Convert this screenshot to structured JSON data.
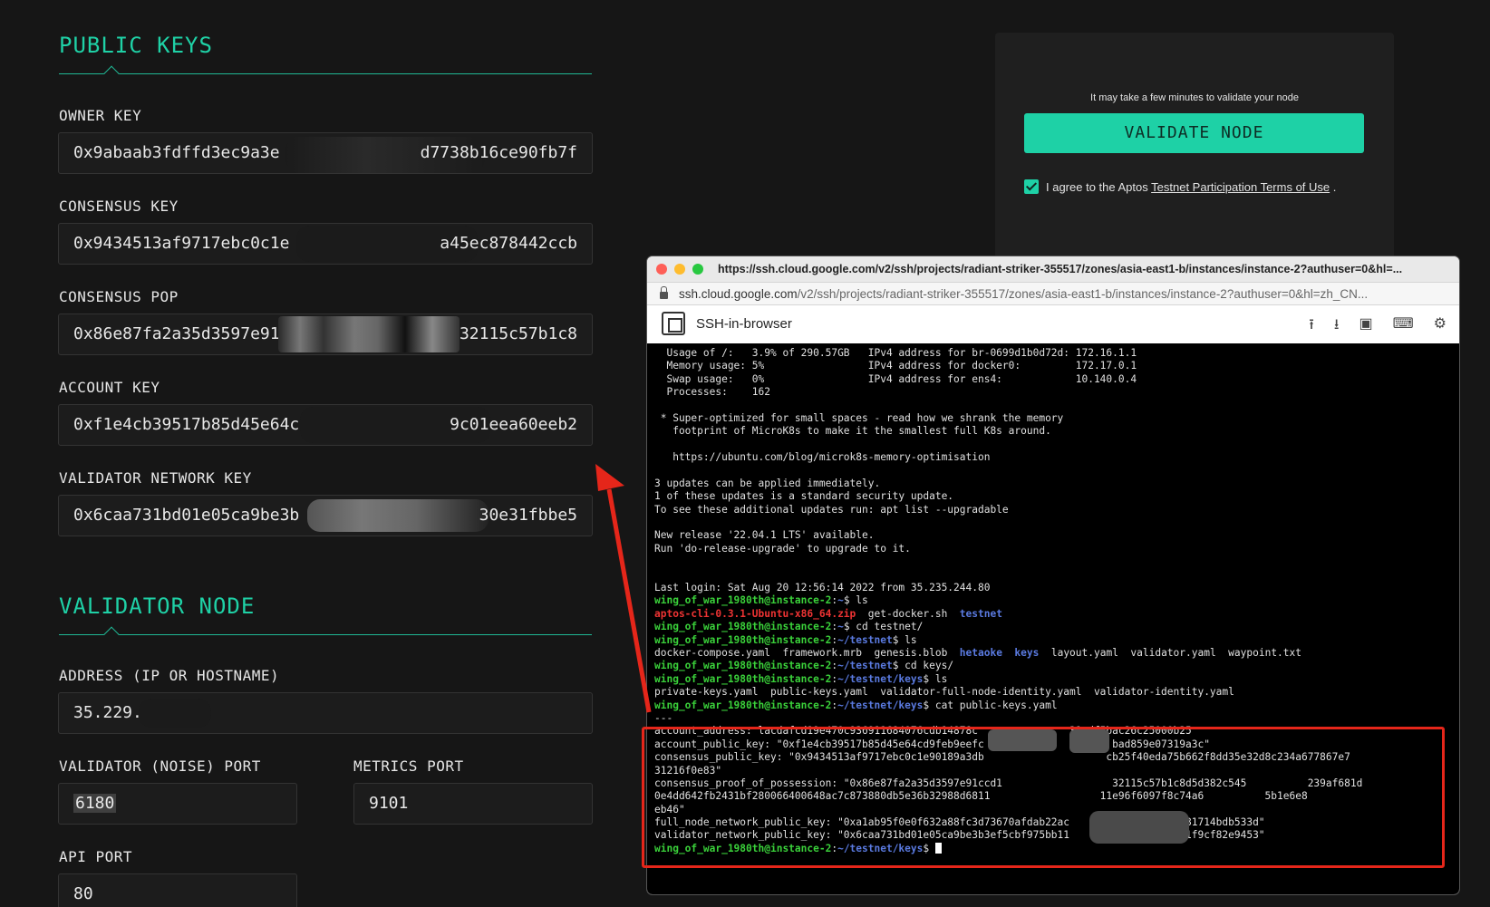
{
  "public_keys": {
    "title": "PUBLIC KEYS",
    "owner_key": {
      "label": "OWNER KEY",
      "left": "0x9abaab3fdffd3ec9a3e",
      "right": "d7738b16ce90fb7f"
    },
    "consensus_key": {
      "label": "CONSENSUS KEY",
      "left": "0x9434513af9717ebc0c1e",
      "right": "a45ec878442ccb"
    },
    "consensus_pop": {
      "label": "CONSENSUS POP",
      "left": "0x86e87fa2a35d3597e91",
      "right": "32115c57b1c8"
    },
    "account_key": {
      "label": "ACCOUNT KEY",
      "left": "0xf1e4cb39517b85d45e64c",
      "right": "9c01eea60eeb2"
    },
    "validator_network_key": {
      "label": "VALIDATOR NETWORK KEY",
      "left": "0x6caa731bd01e05ca9be3b",
      "right": "30e31fbbe5"
    }
  },
  "validator_node": {
    "title": "VALIDATOR NODE",
    "address": {
      "label": "ADDRESS (IP OR HOSTNAME)",
      "value": "35.229."
    },
    "validator_port": {
      "label": "VALIDATOR (NOISE) PORT",
      "value": "6180"
    },
    "metrics_port": {
      "label": "METRICS PORT",
      "value": "9101"
    },
    "api_port": {
      "label": "API PORT",
      "value": "80"
    }
  },
  "validate_panel": {
    "note": "It may take a few minutes to validate your node",
    "button": "VALIDATE NODE",
    "agree_prefix": "I agree to the Aptos",
    "agree_link": "Testnet Participation Terms of Use",
    "agree_suffix": ".",
    "checked": true
  },
  "browser": {
    "title_url": "https://ssh.cloud.google.com/v2/ssh/projects/radiant-striker-355517/zones/asia-east1-b/instances/instance-2?authuser=0&hl=...",
    "address_host": "ssh.cloud.google.com",
    "address_path": "/v2/ssh/projects/radiant-striker-355517/zones/asia-east1-b/instances/instance-2?authuser=0&hl=zh_CN...",
    "app_name": "SSH-in-browser",
    "tool_icons": [
      "upload-icon",
      "download-icon",
      "feedback-icon",
      "keyboard-icon",
      "gear-icon"
    ]
  },
  "terminal": {
    "lines": [
      [
        {
          "t": "  Usage of /:   3.9% of 290.57GB   IPv4 address for br-0699d1b0d72d: 172.16.1.1"
        }
      ],
      [
        {
          "t": "  Memory usage: 5%                 IPv4 address for docker0:         172.17.0.1"
        }
      ],
      [
        {
          "t": "  Swap usage:   0%                 IPv4 address for ens4:            10.140.0.4"
        }
      ],
      [
        {
          "t": "  Processes:    162"
        }
      ],
      [
        {
          "t": ""
        }
      ],
      [
        {
          "t": " * Super-optimized for small spaces - read how we shrank the memory"
        }
      ],
      [
        {
          "t": "   footprint of MicroK8s to make it the smallest full K8s around."
        }
      ],
      [
        {
          "t": ""
        }
      ],
      [
        {
          "t": "   https://ubuntu.com/blog/microk8s-memory-optimisation"
        }
      ],
      [
        {
          "t": ""
        }
      ],
      [
        {
          "t": "3 updates can be applied immediately."
        }
      ],
      [
        {
          "t": "1 of these updates is a standard security update."
        }
      ],
      [
        {
          "t": "To see these additional updates run: apt list --upgradable"
        }
      ],
      [
        {
          "t": ""
        }
      ],
      [
        {
          "t": "New release '22.04.1 LTS' available."
        }
      ],
      [
        {
          "t": "Run 'do-release-upgrade' to upgrade to it."
        }
      ],
      [
        {
          "t": ""
        }
      ],
      [
        {
          "t": ""
        }
      ],
      [
        {
          "t": "Last login: Sat Aug 20 12:56:14 2022 from 35.235.244.80"
        }
      ],
      [
        {
          "t": "wing_of_war_1980th@instance-2",
          "c": "green"
        },
        {
          "t": ":"
        },
        {
          "t": "~",
          "c": "blue"
        },
        {
          "t": "$ ls"
        }
      ],
      [
        {
          "t": "aptos-cli-0.3.1-Ubuntu-x86_64.zip",
          "c": "red"
        },
        {
          "t": "  get-docker.sh  "
        },
        {
          "t": "testnet",
          "c": "blue"
        }
      ],
      [
        {
          "t": "wing_of_war_1980th@instance-2",
          "c": "green"
        },
        {
          "t": ":"
        },
        {
          "t": "~",
          "c": "blue"
        },
        {
          "t": "$ cd testnet/"
        }
      ],
      [
        {
          "t": "wing_of_war_1980th@instance-2",
          "c": "green"
        },
        {
          "t": ":"
        },
        {
          "t": "~/testnet",
          "c": "blue"
        },
        {
          "t": "$ ls"
        }
      ],
      [
        {
          "t": "docker-compose.yaml  framework.mrb  genesis.blob  "
        },
        {
          "t": "hetaoke",
          "c": "blue"
        },
        {
          "t": "  "
        },
        {
          "t": "keys",
          "c": "blue"
        },
        {
          "t": "  layout.yaml  validator.yaml  waypoint.txt"
        }
      ],
      [
        {
          "t": "wing_of_war_1980th@instance-2",
          "c": "green"
        },
        {
          "t": ":"
        },
        {
          "t": "~/testnet",
          "c": "blue"
        },
        {
          "t": "$ cd keys/"
        }
      ],
      [
        {
          "t": "wing_of_war_1980th@instance-2",
          "c": "green"
        },
        {
          "t": ":"
        },
        {
          "t": "~/testnet/keys",
          "c": "blue"
        },
        {
          "t": "$ ls"
        }
      ],
      [
        {
          "t": "private-keys.yaml  public-keys.yaml  validator-full-node-identity.yaml  validator-identity.yaml"
        }
      ],
      [
        {
          "t": "wing_of_war_1980th@instance-2",
          "c": "green"
        },
        {
          "t": ":"
        },
        {
          "t": "~/testnet/keys",
          "c": "blue"
        },
        {
          "t": "$ cat public-keys.yaml"
        }
      ],
      [
        {
          "t": "---"
        }
      ],
      [
        {
          "t": "account_address: lacdafcd19e470c936911684076cdb14878c               31cdf5bac26c25000b25"
        }
      ],
      [
        {
          "t": "account_public_key: \"0xf1e4cb39517b85d45e64cd9feb9eefc                     bad859e07319a3c\""
        }
      ],
      [
        {
          "t": "consensus_public_key: \"0x9434513af9717ebc0c1e90189a3db                    cb25f40eda75b662f8dd35e32d8c234a677867e7"
        }
      ],
      [
        {
          "t": "31216f0e83\""
        }
      ],
      [
        {
          "t": "consensus_proof_of_possession: \"0x86e87fa2a35d3597e91ccd1                  32115c57b1c8d5d382c545          239af681d"
        }
      ],
      [
        {
          "t": "0e4dd642fb2431bf280066400648ac7c873880db5e36b32988d6811                  11e96f6097f8c74a6          5b1e6e8"
        }
      ],
      [
        {
          "t": "eb46\""
        }
      ],
      [
        {
          "t": "full_node_network_public_key: \"0xa1ab95f0e0f632a88fc3d73670afdab22ac                  681714bdb533d\""
        }
      ],
      [
        {
          "t": "validator_network_public_key: \"0x6caa731bd01e05ca9be3b3ef5cbf975bb11                  21f9cf82e9453\""
        }
      ],
      [
        {
          "t": "wing_of_war_1980th@instance-2",
          "c": "green"
        },
        {
          "t": ":"
        },
        {
          "t": "~/testnet/keys",
          "c": "blue"
        },
        {
          "t": "$ "
        },
        {
          "t": "",
          "c": "cursor"
        }
      ]
    ]
  },
  "colors": {
    "accent": "#1fd1a6",
    "annotation": "#e5261a",
    "background": "#161616"
  }
}
